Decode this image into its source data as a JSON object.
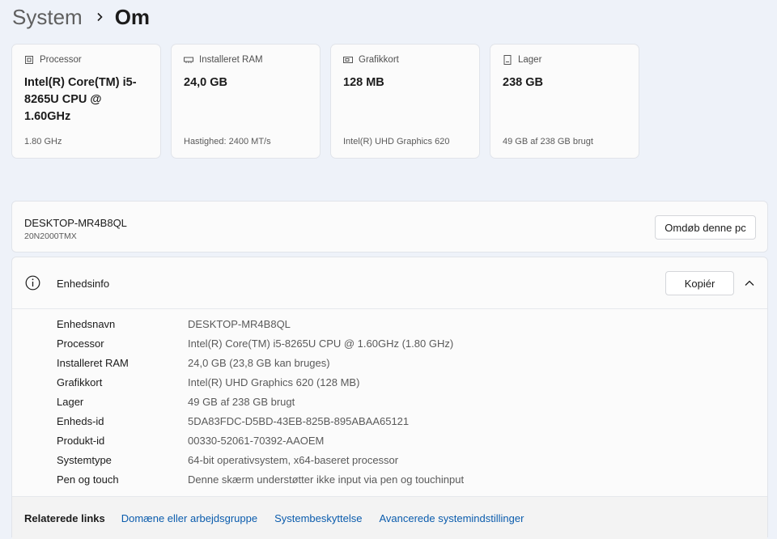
{
  "breadcrumb": {
    "parent": "System",
    "current": "Om"
  },
  "cards": [
    {
      "icon": "processor-chip-icon",
      "label": "Processor",
      "value": "Intel(R) Core(TM) i5-8265U CPU @ 1.60GHz",
      "sub": "1.80 GHz"
    },
    {
      "icon": "ram-module-icon",
      "label": "Installeret RAM",
      "value": "24,0 GB",
      "sub": "Hastighed: 2400 MT/s"
    },
    {
      "icon": "graphics-card-icon",
      "label": "Grafikkort",
      "value": "128 MB",
      "sub": "Intel(R) UHD Graphics 620"
    },
    {
      "icon": "storage-drive-icon",
      "label": "Lager",
      "value": "238 GB",
      "sub": "49 GB af 238 GB brugt"
    }
  ],
  "device": {
    "name": "DESKTOP-MR4B8QL",
    "model": "20N2000TMX",
    "rename_label": "Omdøb denne pc"
  },
  "device_info": {
    "title": "Enhedsinfo",
    "copy_label": "Kopiér",
    "rows": [
      {
        "label": "Enhedsnavn",
        "value": "DESKTOP-MR4B8QL"
      },
      {
        "label": "Processor",
        "value": "Intel(R) Core(TM) i5-8265U CPU @ 1.60GHz (1.80 GHz)"
      },
      {
        "label": "Installeret RAM",
        "value": "24,0 GB (23,8 GB kan bruges)"
      },
      {
        "label": "Grafikkort",
        "value": "Intel(R) UHD Graphics 620 (128 MB)"
      },
      {
        "label": "Lager",
        "value": "49 GB af 238 GB brugt"
      },
      {
        "label": "Enheds-id",
        "value": "5DA83FDC-D5BD-43EB-825B-895ABAA65121"
      },
      {
        "label": "Produkt-id",
        "value": "00330-52061-70392-AAOEM"
      },
      {
        "label": "Systemtype",
        "value": "64-bit operativsystem, x64-baseret processor"
      },
      {
        "label": "Pen og touch",
        "value": "Denne skærm understøtter ikke input via pen og touchinput"
      }
    ]
  },
  "related": {
    "title": "Relaterede links",
    "links": [
      "Domæne eller arbejdsgruppe",
      "Systembeskyttelse",
      "Avancerede systemindstillinger"
    ]
  },
  "colors": {
    "background": "#eef2f9",
    "card": "#fbfbfb",
    "link": "#0b5cad"
  }
}
